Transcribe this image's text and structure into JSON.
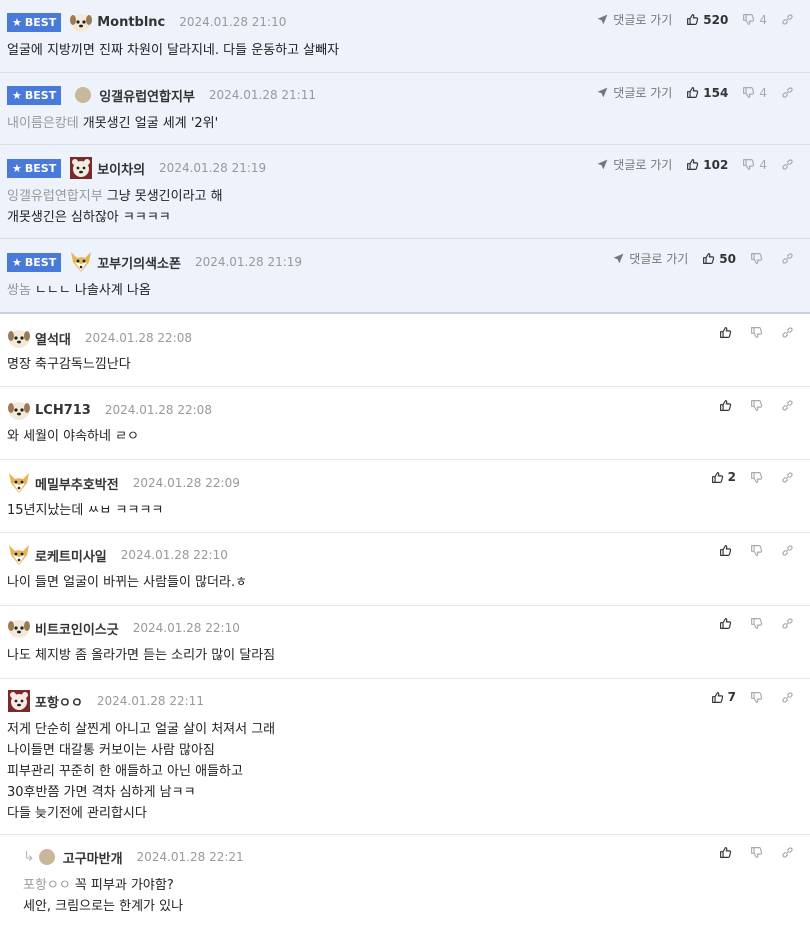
{
  "labels": {
    "best": "BEST",
    "reply_link": "댓글로 가기"
  },
  "comments": [
    {
      "nick": "Montblnc",
      "date": "2024.01.28 21:10",
      "up": "520",
      "down": "4",
      "lines": [
        "얼굴에 지방끼면 진짜 차원이 달라지네. 다들 운동하고 살빼자"
      ]
    },
    {
      "nick": "잉갤유럽연합지부",
      "date": "2024.01.28 21:11",
      "up": "154",
      "down": "4",
      "ref": "내이름은캉테",
      "lines": [
        "개못생긴 얼굴 세계 '2위'"
      ]
    },
    {
      "nick": "보이차의",
      "date": "2024.01.28 21:19",
      "up": "102",
      "down": "4",
      "ref": "잉갤유럽연합지부",
      "lines": [
        "그냥 못생긴이라고 해",
        "개못생긴은 심하잖아 ㅋㅋㅋㅋ"
      ]
    },
    {
      "nick": "꼬부기의색소폰",
      "date": "2024.01.28 21:19",
      "up": "50",
      "ref": "쌍놈",
      "lines": [
        "ㄴㄴㄴ 나솔사계 나옴"
      ]
    },
    {
      "nick": "열석대",
      "date": "2024.01.28 22:08",
      "lines": [
        "명장 축구감독느낌난다"
      ]
    },
    {
      "nick": "LCH713",
      "date": "2024.01.28 22:08",
      "lines": [
        "와 세월이 야속하네 ㄹㅇ"
      ]
    },
    {
      "nick": "메밀부추호박전",
      "date": "2024.01.28 22:09",
      "up": "2",
      "lines": [
        "15년지났는데 ㅆㅂ ㅋㅋㅋㅋ"
      ]
    },
    {
      "nick": "로케트미사일",
      "date": "2024.01.28 22:10",
      "lines": [
        "나이 들면 얼굴이 바뀌는 사람들이 많더라.ㅎ"
      ]
    },
    {
      "nick": "비트코인이스긋",
      "date": "2024.01.28 22:10",
      "lines": [
        "나도 체지방 좀 올라가면 듣는 소리가 많이 달라짐"
      ]
    },
    {
      "nick": "포항ㅇㅇ",
      "date": "2024.01.28 22:11",
      "up": "7",
      "lines": [
        "저게 단순히 살찐게 아니고 얼굴 살이 처져서 그래",
        "나이들면 대갈통 커보이는 사람 많아짐",
        "피부관리 꾸준히 한 애들하고 아닌 애들하고",
        "30후반쯤 가면 격차 심하게 남ㅋㅋ",
        "다들 늦기전에 관리합시다"
      ]
    },
    {
      "nick": "고구마반개",
      "date": "2024.01.28 22:21",
      "ref": "포항ㅇㅇ",
      "lines": [
        "꼭 피부과 가야함?",
        "세안, 크림으로는 한계가 있나"
      ]
    }
  ],
  "colors": {
    "best_badge": "#4a7ad9",
    "best_bg": "#edf2fb"
  },
  "icons": [
    "star-icon",
    "send-icon",
    "thumbs-up-icon",
    "thumbs-down-icon",
    "link-icon",
    "reply-arrow-icon",
    "avatar-dog-icon"
  ]
}
